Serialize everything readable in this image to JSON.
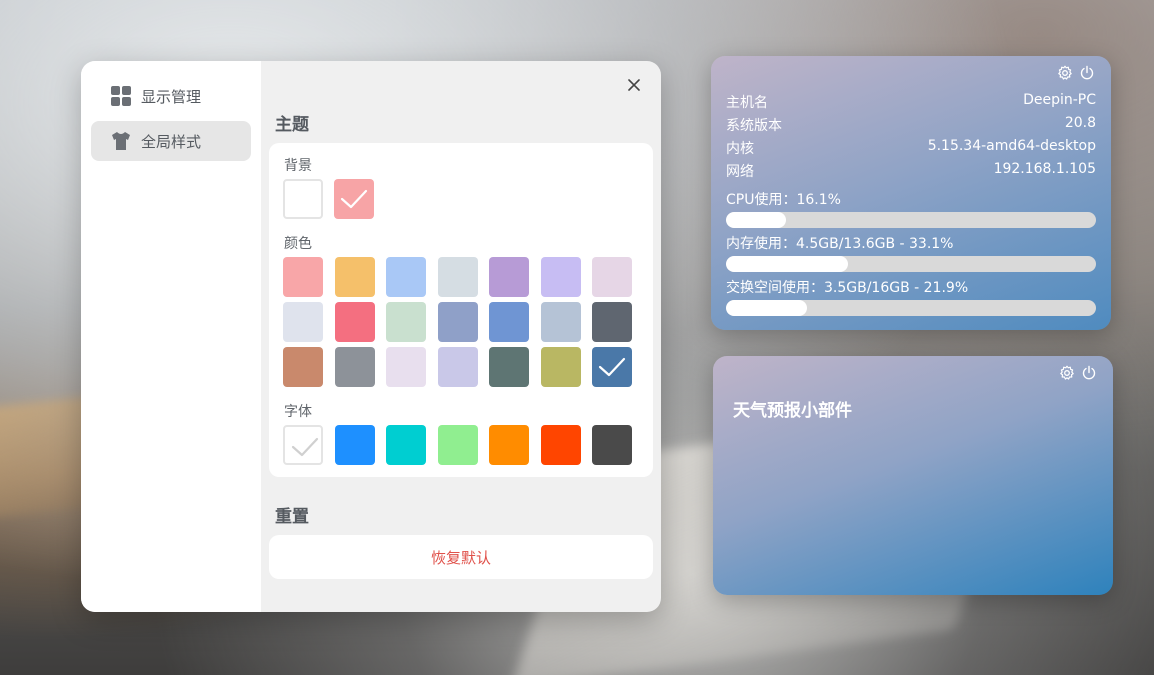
{
  "sidebar": {
    "items": [
      {
        "label": "显示管理",
        "icon": "grid-icon"
      },
      {
        "label": "全局样式",
        "icon": "tshirt-icon",
        "active": true
      }
    ]
  },
  "theme": {
    "title": "主题",
    "background_label": "背景",
    "color_label": "颜色",
    "font_label": "字体",
    "background_options": [
      {
        "name": "white",
        "color": "#ffffff",
        "selected": false
      },
      {
        "name": "pink",
        "color": "#f7a4a6",
        "selected": true
      }
    ],
    "color_options": [
      [
        "#f8a6a8",
        "#f5c06a",
        "#a9c8f6",
        "#d5dde3",
        "#b79bd6",
        "#c7bdf3",
        "#e6d6e6"
      ],
      [
        "#dfe3ed",
        "#f46f80",
        "#c9e0cf",
        "#8fa0c8",
        "#6f95d3",
        "#b5c3d6",
        "#5f6670"
      ],
      [
        "#c9896c",
        "#8d9299",
        "#e8dfee",
        "#c9c8e8",
        "#5e7573",
        "#b9b763",
        "#4a78a8"
      ]
    ],
    "selected_color_index": [
      2,
      6
    ],
    "font_colors": [
      "#ffffff",
      "#1e90ff",
      "#00ced1",
      "#90ee90",
      "#ff8c00",
      "#ff4500",
      "#4a4a4a"
    ],
    "selected_font_index": 0
  },
  "reset": {
    "title": "重置",
    "button_label": "恢复默认"
  },
  "sys_widget": {
    "rows": [
      {
        "label": "主机名",
        "value": "Deepin-PC"
      },
      {
        "label": "系统版本",
        "value": "20.8"
      },
      {
        "label": "内核",
        "value": "5.15.34-amd64-desktop"
      },
      {
        "label": "网络",
        "value": "192.168.1.105"
      }
    ],
    "cpu": {
      "label": "CPU使用：16.1%",
      "percent": 16.1
    },
    "mem": {
      "label": "内存使用：4.5GB/13.6GB - 33.1%",
      "percent": 33.1
    },
    "swap": {
      "label": "交换空间使用：3.5GB/16GB - 21.9%",
      "percent": 21.9
    }
  },
  "weather_widget": {
    "title": "天气预报小部件"
  },
  "colors": {
    "accent_red": "#e0514a",
    "widget_blue": "#4f8bbf"
  }
}
